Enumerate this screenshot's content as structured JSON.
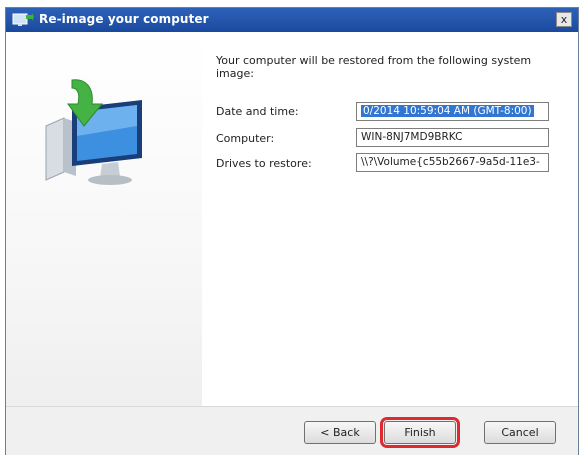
{
  "window": {
    "title": "Re-image your computer",
    "close_glyph": "x"
  },
  "main": {
    "intro": "Your computer will be restored from the following system image:",
    "fields": [
      {
        "label": "Date and time:",
        "value": "0/2014 10:59:04 AM (GMT-8:00)",
        "selected": true
      },
      {
        "label": "Computer:",
        "value": "WIN-8NJ7MD9BRKC"
      },
      {
        "label": "Drives to restore:",
        "value": "\\\\?\\Volume{c55b2667-9a5d-11e3-"
      }
    ]
  },
  "footer": {
    "back_label": "< Back",
    "finish_label": "Finish",
    "cancel_label": "Cancel"
  },
  "colors": {
    "titlebar": "#1a4a9e",
    "selection": "#3276d1",
    "highlight_box": "#e0282f"
  },
  "icons": {
    "title": "computer-restore-icon",
    "illustration": "monitor-with-green-arrow-icon"
  }
}
